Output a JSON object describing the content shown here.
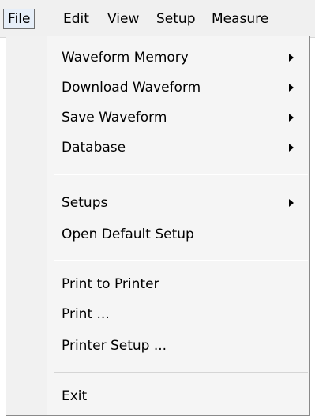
{
  "menubar": {
    "items": [
      {
        "label": "File"
      },
      {
        "label": "Edit"
      },
      {
        "label": "View"
      },
      {
        "label": "Setup"
      },
      {
        "label": "Measure"
      }
    ]
  },
  "file_menu": {
    "items": [
      {
        "label": "Waveform Memory",
        "submenu": true
      },
      {
        "label": "Download Waveform",
        "submenu": true
      },
      {
        "label": "Save Waveform",
        "submenu": true
      },
      {
        "label": "Database",
        "submenu": true
      },
      {
        "label": "Setups",
        "submenu": true
      },
      {
        "label": "Open Default Setup",
        "submenu": false
      },
      {
        "label": "Print to Printer",
        "submenu": false
      },
      {
        "label": "Print ...",
        "submenu": false
      },
      {
        "label": "Printer Setup ...",
        "submenu": false
      },
      {
        "label": "Exit",
        "submenu": false
      }
    ]
  },
  "colors": {
    "menu_background": "#f5f5f5",
    "active_menubar_item": "#e6eef8",
    "text": "#000000"
  },
  "icons": {
    "submenu_arrow": "chevron-right-icon"
  }
}
